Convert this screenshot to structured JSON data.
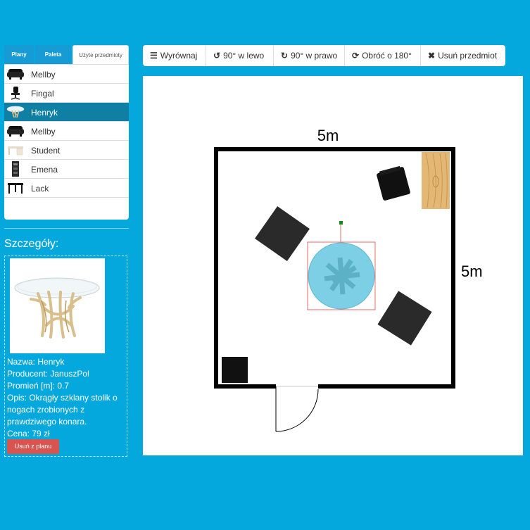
{
  "tabs": {
    "plans": "Plany",
    "palette": "Paleta",
    "used_items": "Użyte przedmioty"
  },
  "used_items": [
    {
      "name": "Mellby",
      "icon": "armchair-icon"
    },
    {
      "name": "Fingal",
      "icon": "office-chair-icon"
    },
    {
      "name": "Henryk",
      "icon": "glass-table-icon",
      "selected": true
    },
    {
      "name": "Mellby",
      "icon": "armchair-icon"
    },
    {
      "name": "Student",
      "icon": "desk-icon"
    },
    {
      "name": "Emena",
      "icon": "cabinet-icon"
    },
    {
      "name": "Lack",
      "icon": "side-table-icon"
    }
  ],
  "details": {
    "heading": "Szczegóły:",
    "name_line": "Nazwa: Henryk",
    "producer_line": "Producent: JanuszPol",
    "radius_line": "Promień [m]: 0.7",
    "description_line": "Opis: Okrągły szklany stolik o nogach zrobionych z prawdziwego konara.",
    "price_line": "Cena: 79 zł",
    "remove_label": "Usuń z planu"
  },
  "toolbar": {
    "align_label": "Wyrównaj",
    "rotate_left_label": "90° w lewo",
    "rotate_right_label": "90° w prawo",
    "rotate_180_label": "Obróć o 180°",
    "delete_label": "Usuń przedmiot"
  },
  "plan": {
    "width_label": "5m",
    "height_label": "5m"
  },
  "colors": {
    "background": "#05a8dc",
    "selected_row": "#0f7fa3",
    "danger": "#d9534f",
    "selection_box": "#e86a6a",
    "table_glass": "#7ccfe4"
  }
}
